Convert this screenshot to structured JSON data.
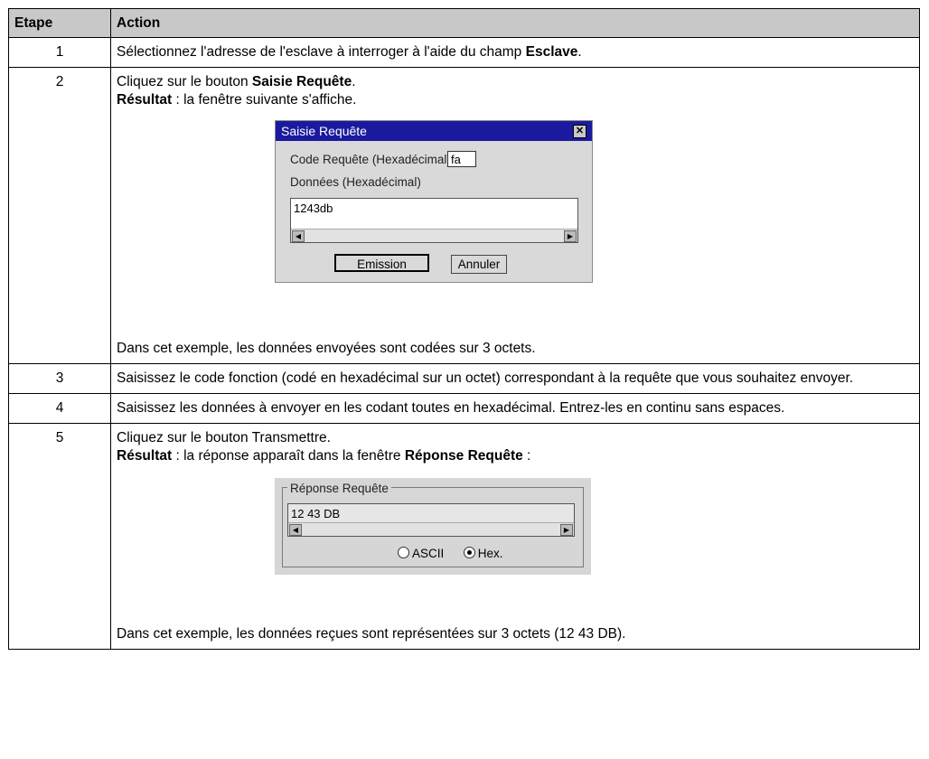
{
  "header": {
    "step": "Etape",
    "action": "Action"
  },
  "rows": [
    {
      "step": "1",
      "pre": "Sélectionnez l'adresse de l'esclave à interroger à l'aide du champ ",
      "bold": "Esclave",
      "post": "."
    },
    {
      "step": "2",
      "pre": "Cliquez sur le bouton ",
      "bold": "Saisie Requête",
      "post": ".",
      "result_label": "Résultat",
      "result_text": " : la fenêtre suivante s'affiche.",
      "note": "Dans cet exemple, les données envoyées sont codées sur 3 octets."
    },
    {
      "step": "3",
      "text": "Saisissez le code fonction (codé en hexadécimal sur un octet) correspondant à la requête que vous souhaitez envoyer."
    },
    {
      "step": "4",
      "text": "Saisissez les données à envoyer en les codant toutes en hexadécimal. Entrez-les en continu sans espaces."
    },
    {
      "step": "5",
      "text": "Cliquez sur le bouton Transmettre.",
      "result_label": "Résultat",
      "result_text": " : la réponse apparaît dans la fenêtre ",
      "result_bold": "Réponse Requête",
      "result_post": " :",
      "note": "Dans cet exemple, les données reçues sont représentées sur 3 octets (12 43 DB)."
    }
  ],
  "dialog": {
    "title": "Saisie Requête",
    "close": "✕",
    "code_label": "Code Requête (Hexadécimal)",
    "code_value": "fa",
    "data_label": "Données (Hexadécimal)",
    "data_value": "1243db",
    "emit_button": "Emission",
    "cancel_button": "Annuler"
  },
  "response_panel": {
    "legend": "Réponse Requête",
    "value": "12 43 DB",
    "ascii": "ASCII",
    "hex": "Hex.",
    "selected": "Hex."
  }
}
